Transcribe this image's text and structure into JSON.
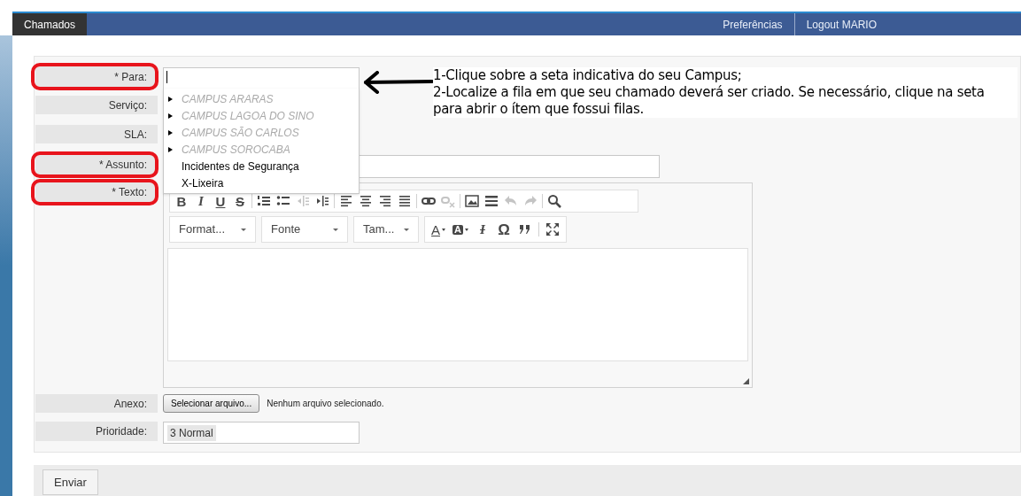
{
  "nav": {
    "items": [
      {
        "label": "Chamados",
        "selected": true
      },
      {
        "label": "Preferências",
        "selected": false
      },
      {
        "label": "Logout MARIO",
        "selected": false
      }
    ]
  },
  "form": {
    "fields": [
      {
        "label": "* Para:",
        "kind": "queue",
        "highlighted": true
      },
      {
        "label": "Serviço:",
        "kind": "empty",
        "highlighted": false
      },
      {
        "label": "SLA:",
        "kind": "empty",
        "highlighted": false
      },
      {
        "label": "* Assunto:",
        "kind": "text",
        "highlighted": true
      },
      {
        "label": "* Texto:",
        "kind": "editor",
        "highlighted": true
      },
      {
        "label": "Anexo:",
        "kind": "file",
        "highlighted": false,
        "button": "Selecionar arquivo...",
        "status": "Nenhum arquivo selecionado."
      },
      {
        "label": "Prioridade:",
        "kind": "select",
        "highlighted": false,
        "value": "3 Normal"
      }
    ]
  },
  "queue_dropdown": {
    "items": [
      {
        "label": "CAMPUS ARARAS",
        "has_children": true
      },
      {
        "label": "CAMPUS LAGOA DO SINO",
        "has_children": true
      },
      {
        "label": "CAMPUS SÃO CARLOS",
        "has_children": true
      },
      {
        "label": "CAMPUS SOROCABA",
        "has_children": true
      },
      {
        "label": "Incidentes de Segurança",
        "has_children": false
      },
      {
        "label": "X-Lixeira",
        "has_children": false
      }
    ]
  },
  "annotation": {
    "lines": [
      "1-Clique sobre a seta indicativa do seu Campus;",
      "2-Localize a fila em que seu chamado deverá ser criado. Se necessário, clique na seta para abrir o ítem que fossui filas."
    ]
  },
  "editor": {
    "toolbar_row_1": [
      [
        {
          "kind": "bold",
          "label": "B",
          "disabled": false
        },
        {
          "kind": "italic",
          "label": "I",
          "disabled": false
        },
        {
          "kind": "underline",
          "label": "U",
          "disabled": false
        },
        {
          "kind": "strike",
          "label": "S",
          "disabled": false
        }
      ],
      [
        {
          "kind": "numbered-list",
          "disabled": false
        },
        {
          "kind": "bulleted-list",
          "disabled": false
        },
        {
          "kind": "outdent",
          "disabled": true
        },
        {
          "kind": "indent",
          "disabled": false
        }
      ],
      [
        {
          "kind": "align-left",
          "disabled": false
        },
        {
          "kind": "align-center",
          "disabled": false
        },
        {
          "kind": "align-right",
          "disabled": false
        },
        {
          "kind": "justify",
          "disabled": false
        }
      ],
      [
        {
          "kind": "link",
          "disabled": false
        },
        {
          "kind": "unlink",
          "disabled": true
        }
      ],
      [
        {
          "kind": "image",
          "disabled": false
        },
        {
          "kind": "horizontal-rule",
          "disabled": false
        },
        {
          "kind": "undo",
          "disabled": true
        },
        {
          "kind": "redo",
          "disabled": true
        }
      ],
      [
        {
          "kind": "search",
          "disabled": false
        }
      ]
    ],
    "combos": [
      {
        "label": "Format..."
      },
      {
        "label": "Fonte"
      },
      {
        "label": "Tam..."
      }
    ],
    "toolbar_row_2": [
      {
        "kind": "text-color",
        "label": "A",
        "disabled": false
      },
      {
        "kind": "background-color",
        "label": "A",
        "disabled": false
      },
      {
        "kind": "remove-format",
        "label": "I",
        "disabled": false
      },
      {
        "kind": "special-char",
        "label": "Ω",
        "disabled": false
      },
      {
        "kind": "blockquote",
        "disabled": false
      },
      {
        "kind": "maximize",
        "disabled": false
      }
    ]
  },
  "footer": {
    "button": "Enviar"
  }
}
